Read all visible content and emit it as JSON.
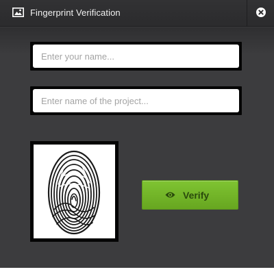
{
  "window": {
    "title": "Fingerprint Verification",
    "title_icon": "image-icon",
    "close_icon": "close-icon"
  },
  "form": {
    "name_field": {
      "placeholder": "Enter your name...",
      "value": ""
    },
    "project_field": {
      "placeholder": "Enter name of the project...",
      "value": ""
    }
  },
  "fingerprint": {
    "icon": "fingerprint-image"
  },
  "verify_button": {
    "label": "Verify",
    "icon": "eye-icon",
    "color": "#75b82a"
  }
}
